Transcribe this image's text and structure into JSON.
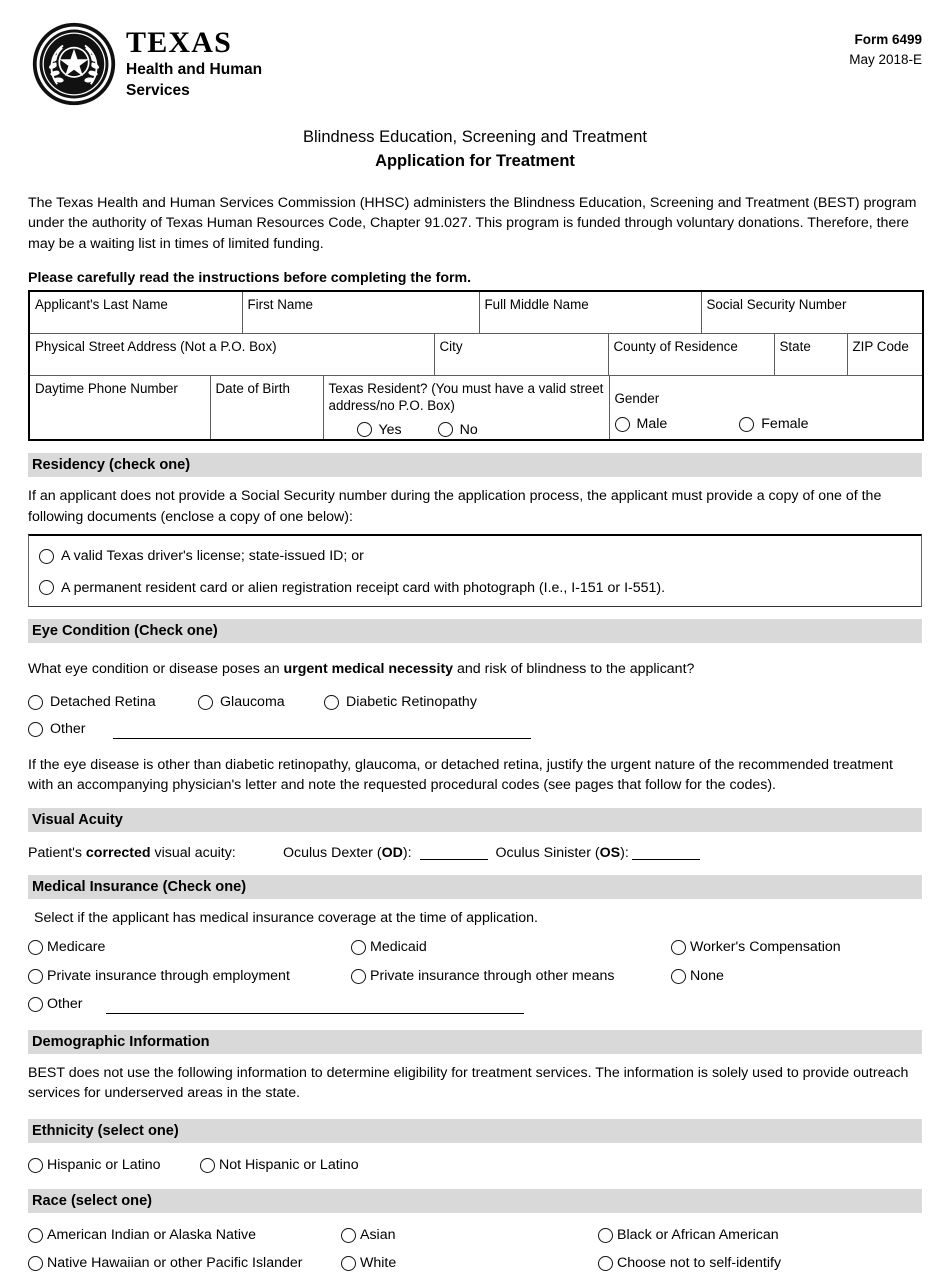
{
  "header": {
    "logo": {
      "seal_icon": "texas-state-seal-icon",
      "wordmark": "TEXAS",
      "sub_line_1": "Health and Human",
      "sub_line_2": "Services"
    },
    "form_number": "Form 6499",
    "form_revision": "May 2018-E"
  },
  "title": {
    "program": "Blindness Education, Screening and Treatment",
    "document": "Application for Treatment"
  },
  "intro": "The Texas Health and Human Services Commission (HHSC) administers the Blindness Education, Screening and Treatment (BEST) program under the authority of Texas Human Resources Code, Chapter 91.027. This program is funded through voluntary donations. Therefore, there may be a waiting list in times of limited funding.",
  "instruction": "Please carefully read the instructions before completing the form.",
  "applicant_table": {
    "row1": [
      {
        "label": "Applicant's Last Name",
        "value": ""
      },
      {
        "label": "First Name",
        "value": ""
      },
      {
        "label": "Full Middle Name",
        "value": ""
      },
      {
        "label": "Social Security Number",
        "value": ""
      }
    ],
    "row2": [
      {
        "label": "Physical Street Address (Not a P.O. Box)",
        "value": ""
      },
      {
        "label": "City",
        "value": ""
      },
      {
        "label": "County of Residence",
        "value": ""
      },
      {
        "label": "State",
        "value": ""
      },
      {
        "label": "ZIP Code",
        "value": ""
      }
    ],
    "row3": {
      "phone_label": "Daytime Phone Number",
      "dob_label": "Date of Birth",
      "resident_label": "Texas Resident? (You must have a valid street address/no P.O. Box)",
      "resident_options": [
        "Yes",
        "No"
      ],
      "gender_label": "Gender",
      "gender_options": [
        "Male",
        "Female"
      ]
    }
  },
  "residency": {
    "heading": "Residency (check one)",
    "body": "If an applicant does not provide a Social Security number during the application process, the applicant must provide a copy of one of the following documents  (enclose a copy of one below):",
    "options": [
      "A valid Texas driver's license; state-issued ID; or",
      "A permanent resident card or alien registration receipt card with photograph (I.e., I-151 or I-551)."
    ]
  },
  "eye_condition": {
    "heading": "Eye Condition (Check one)",
    "question_pre": "What eye condition or disease poses an ",
    "question_bold": "urgent medical necessity",
    "question_post": " and risk of blindness to the applicant?",
    "options_row1": [
      "Detached Retina",
      "Glaucoma",
      "Diabetic Retinopathy"
    ],
    "other_label": "Other",
    "other_value": "",
    "note": "If the eye disease is other than diabetic retinopathy, glaucoma, or detached retina, justify the urgent nature of the recommended treatment with an accompanying physician's letter and note the requested procedural codes (see pages that follow for the codes)."
  },
  "visual_acuity": {
    "heading": "Visual Acuity",
    "prefix": "Patient's ",
    "bold_word": "corrected",
    "suffix": " visual acuity:",
    "od_label_pre": "Oculus Dexter (",
    "od_label_bold": "OD",
    "od_label_post": "):",
    "od_value": "",
    "os_label_pre": "Oculus Sinister (",
    "os_label_bold": "OS",
    "os_label_post": "):",
    "os_value": ""
  },
  "medical_insurance": {
    "heading": "Medical Insurance (Check one)",
    "body": "Select if the applicant has medical insurance coverage at the time of application.",
    "col1": [
      "Medicare",
      "Private insurance through employment"
    ],
    "col2": [
      "Medicaid",
      "Private insurance through other means"
    ],
    "col3": [
      "Worker's Compensation",
      "None"
    ],
    "other_label": "Other",
    "other_value": ""
  },
  "demographic": {
    "heading": "Demographic Information",
    "body": "BEST does not use the following information to determine eligibility for treatment services. The information is solely used to provide outreach services for underserved areas in the state."
  },
  "ethnicity": {
    "heading": "Ethnicity (select one)",
    "options": [
      "Hispanic or Latino",
      "Not Hispanic or Latino"
    ]
  },
  "race": {
    "heading": "Race (select one)",
    "col1": [
      "American Indian or Alaska Native",
      "Native Hawaiian or other Pacific Islander"
    ],
    "col2": [
      "Asian",
      "White"
    ],
    "col3": [
      "Black or African American",
      "Choose not to self-identify"
    ]
  },
  "colors": {
    "section_bar": "#d9d9d9",
    "text": "#000000",
    "border_dark": "#000000",
    "border_light": "#5d5d5d"
  }
}
